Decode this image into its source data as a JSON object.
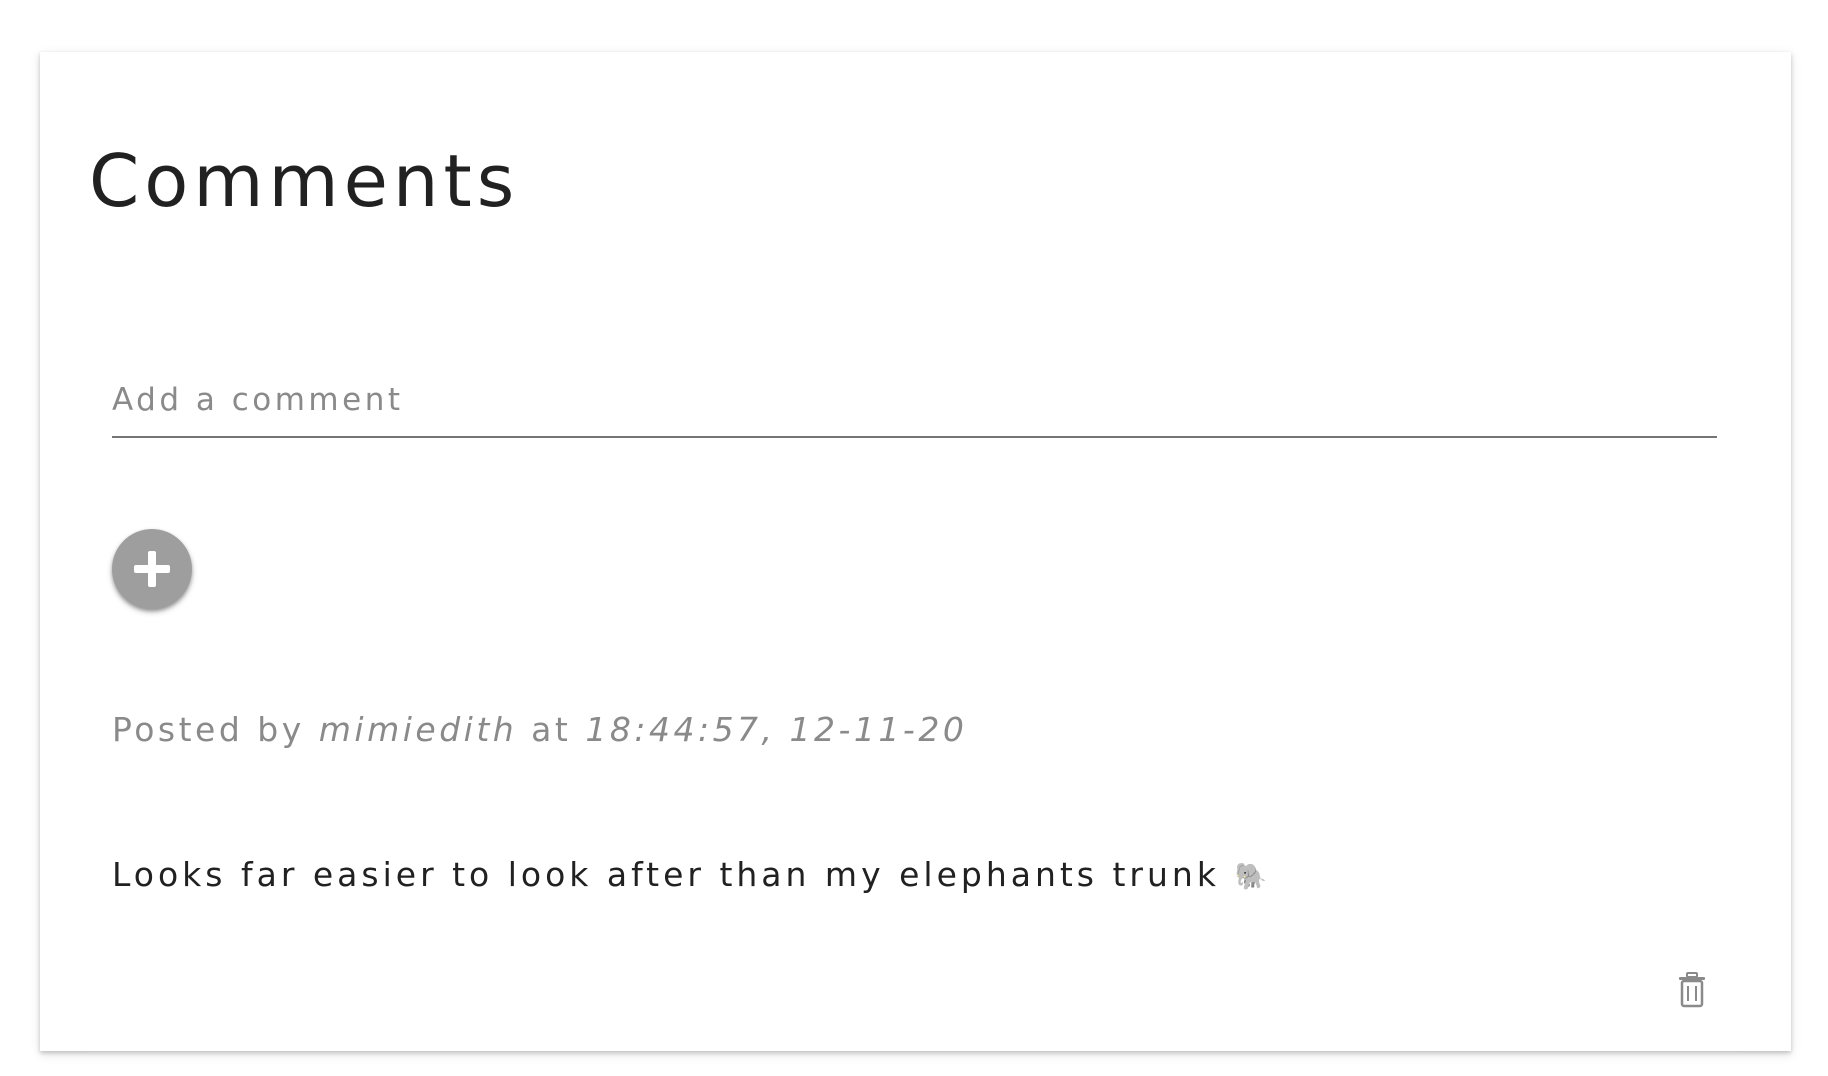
{
  "comments_section": {
    "title": "Comments",
    "input": {
      "placeholder": "Add a comment",
      "value": ""
    },
    "add_button_icon": "plus-icon",
    "add_button_color": "#9e9e9e"
  },
  "comments": [
    {
      "posted_prefix": "Posted by",
      "author": "mimiedith",
      "at_text": "at",
      "timestamp": "18:44:57, 12-11-20",
      "text": "Looks far easier to look after than my elephants trunk",
      "emoji": "🐘",
      "delete_icon": "trash-icon"
    }
  ]
}
